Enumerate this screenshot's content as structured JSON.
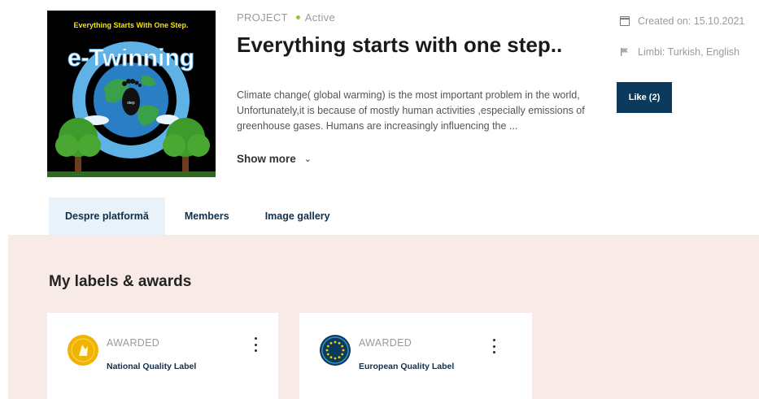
{
  "project": {
    "type_label": "PROJECT",
    "status": "Active",
    "title": "Everything starts with one step..",
    "description": "Climate change( global warming) is the most important problem in the world, Unfortunately,it is because of mostly human activities ,especially emissions of greenhouse gases. Humans are increasingly influencing the ...",
    "show_more": "Show more",
    "image": {
      "heading": "Everything Starts With One Step.",
      "logo_text": "e-Twinning",
      "footprint_text": "step"
    }
  },
  "side": {
    "created": "Created on: 15.10.2021",
    "languages": "Limbi: Turkish, English",
    "like_label": "Like (2)"
  },
  "tabs": [
    {
      "label": "Despre platformă",
      "active": true
    },
    {
      "label": "Members",
      "active": false
    },
    {
      "label": "Image gallery",
      "active": false
    }
  ],
  "labels_section": {
    "title": "My labels & awards",
    "cards": [
      {
        "status": "AWARDED",
        "name": "National Quality Label",
        "badge_color": "#f0b400"
      },
      {
        "status": "AWARDED",
        "name": "European Quality Label",
        "badge_color": "#0b3a5c"
      }
    ]
  },
  "colors": {
    "accent": "#0b3a5c",
    "active_dot": "#8cc63f",
    "tab_active_bg": "#e8f2f8",
    "panel_bg": "#f8ebe7"
  }
}
